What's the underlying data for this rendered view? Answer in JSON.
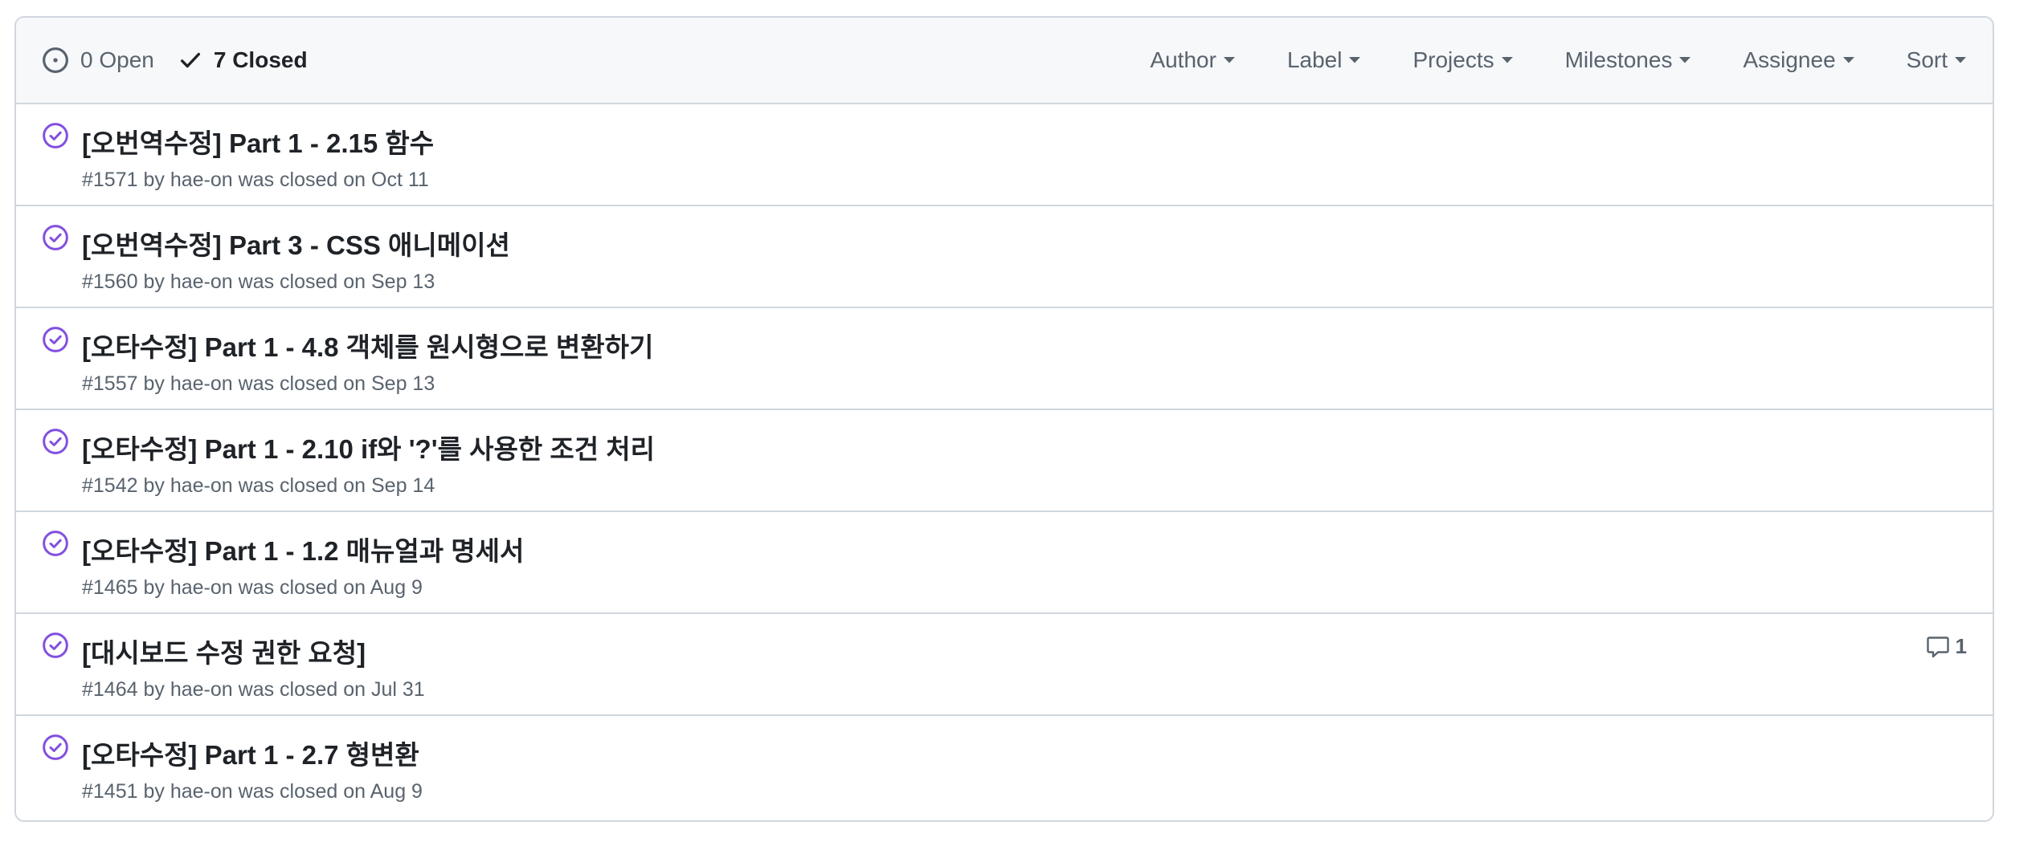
{
  "header": {
    "open_label": "0 Open",
    "closed_label": "7 Closed",
    "filters": [
      "Author",
      "Label",
      "Projects",
      "Milestones",
      "Assignee",
      "Sort"
    ]
  },
  "colors": {
    "closed_icon": "#8250df",
    "muted_text": "#59636e",
    "border": "#d0d7de",
    "header_bg": "#f6f8fa"
  },
  "icons": {
    "open": "issue-opened-icon",
    "closed_state": "check-icon",
    "row": "issue-closed-icon",
    "comment": "comment-icon",
    "caret": "triangle-down-icon"
  },
  "issues": [
    {
      "title": "[오번역수정] Part 1 - 2.15 함수",
      "meta_prefix": "#1571 by ",
      "author": "hae-on",
      "meta_suffix": " was closed on Oct 11",
      "comments": ""
    },
    {
      "title": "[오번역수정] Part 3 - CSS 애니메이션",
      "meta_prefix": "#1560 by ",
      "author": "hae-on",
      "meta_suffix": " was closed on Sep 13",
      "comments": ""
    },
    {
      "title": "[오타수정] Part 1 - 4.8 객체를 원시형으로 변환하기",
      "meta_prefix": "#1557 by ",
      "author": "hae-on",
      "meta_suffix": " was closed on Sep 13",
      "comments": ""
    },
    {
      "title": "[오타수정] Part 1 - 2.10 if와 '?'를 사용한 조건 처리",
      "meta_prefix": "#1542 by ",
      "author": "hae-on",
      "meta_suffix": " was closed on Sep 14",
      "comments": ""
    },
    {
      "title": "[오타수정] Part 1 - 1.2 매뉴얼과 명세서",
      "meta_prefix": "#1465 by ",
      "author": "hae-on",
      "meta_suffix": " was closed on Aug 9",
      "comments": ""
    },
    {
      "title": "[대시보드 수정 권한 요청]",
      "meta_prefix": "#1464 by ",
      "author": "hae-on",
      "meta_suffix": " was closed on Jul 31",
      "comments": "1"
    },
    {
      "title": "[오타수정] Part 1 - 2.7 형변환",
      "meta_prefix": "#1451 by ",
      "author": "hae-on",
      "meta_suffix": " was closed on Aug 9",
      "comments": ""
    }
  ]
}
